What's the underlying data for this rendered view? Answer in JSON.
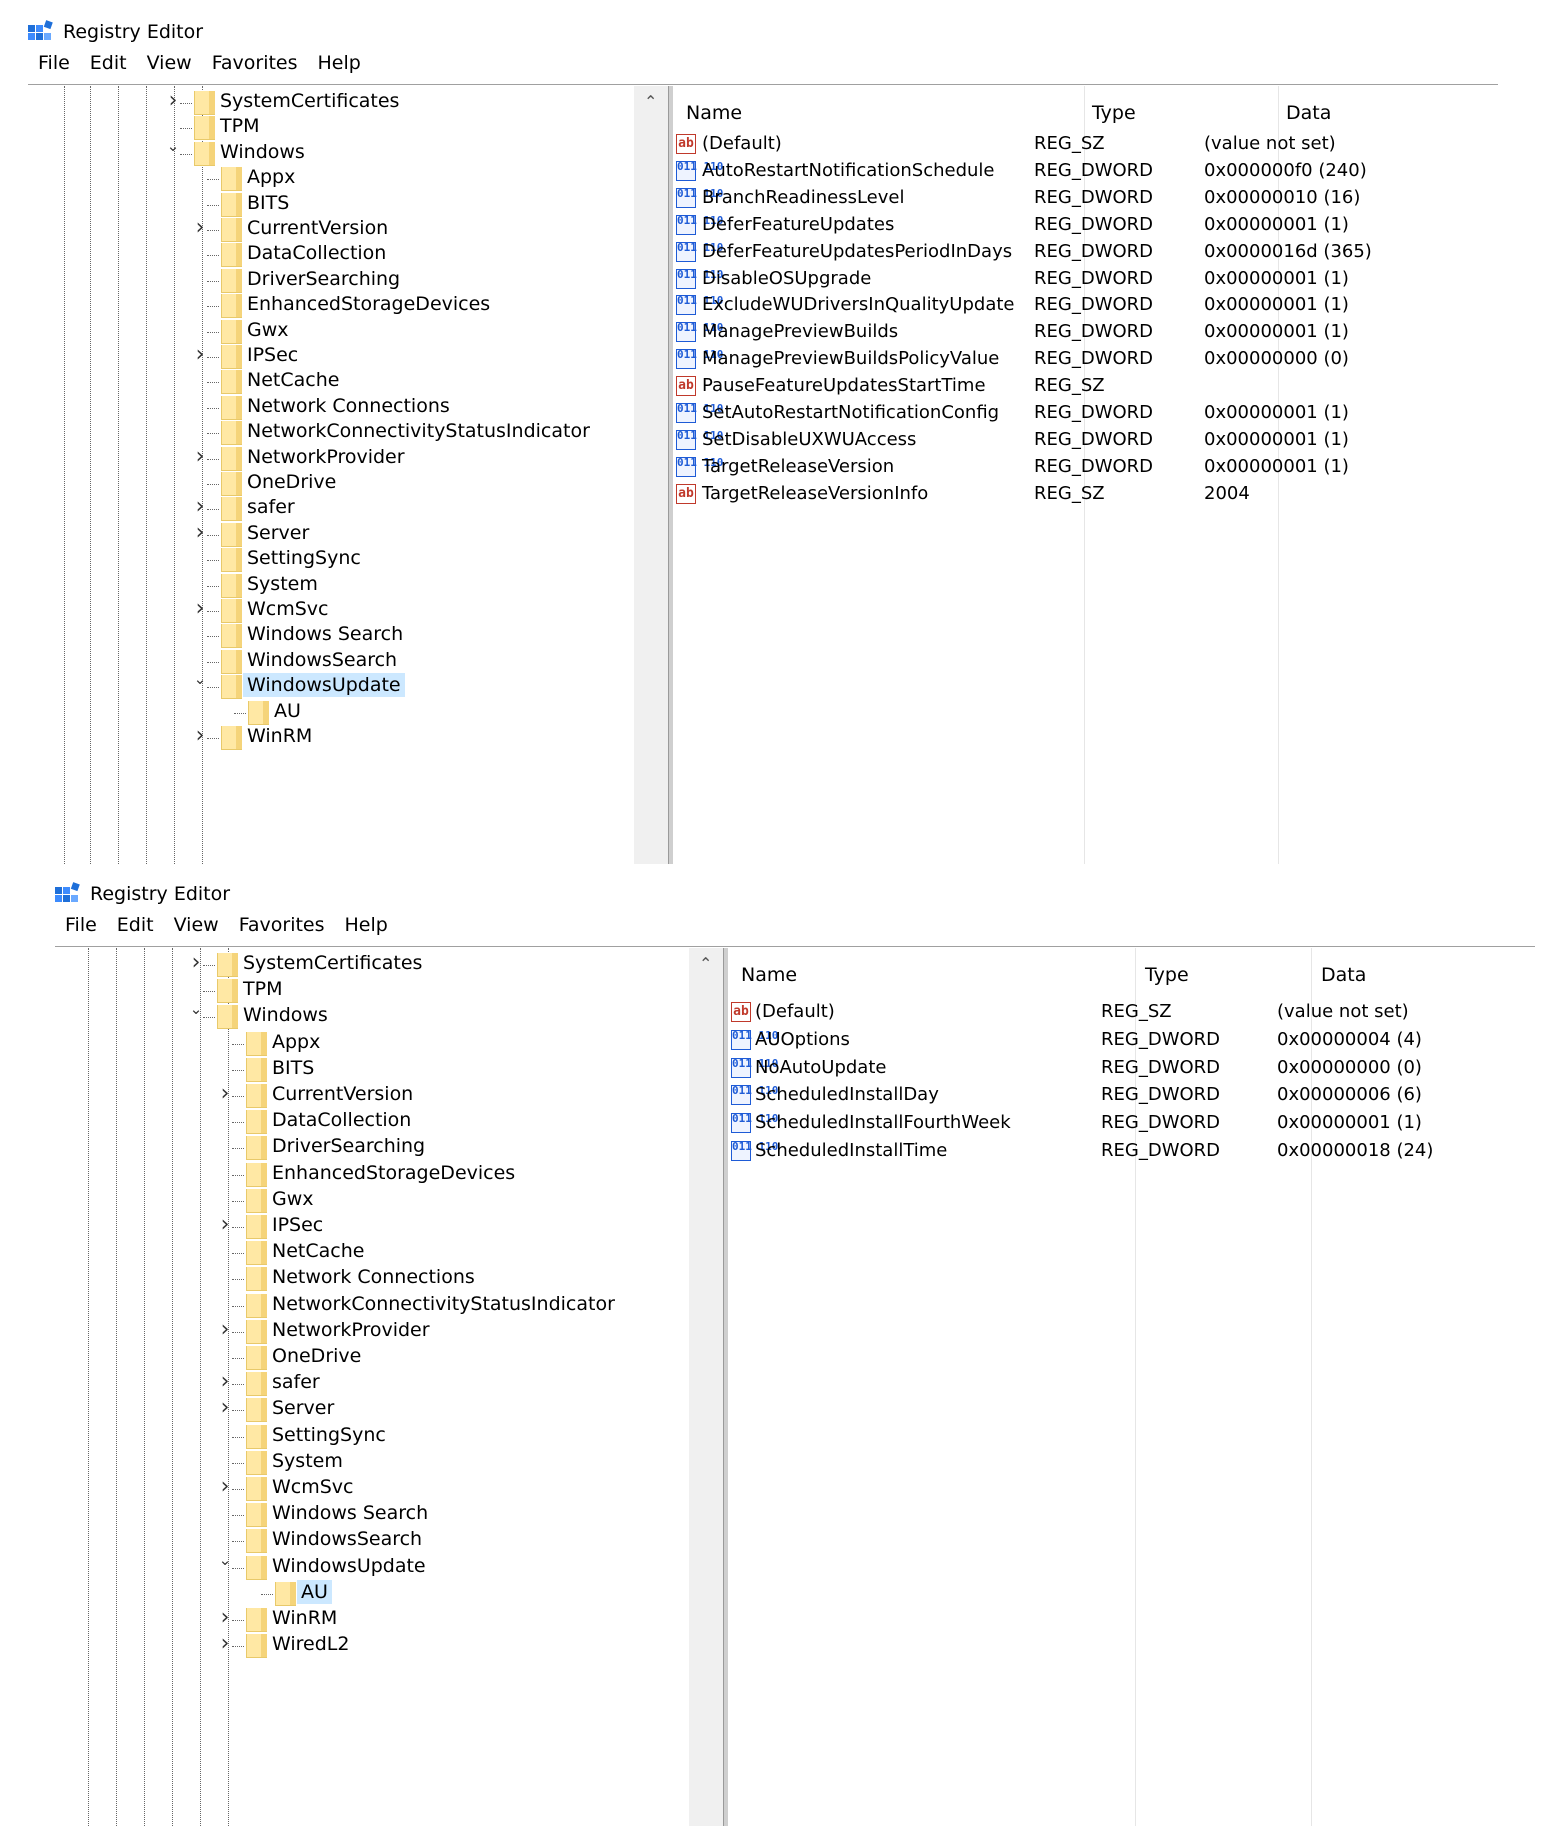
{
  "app_title": "Registry Editor",
  "menu": [
    "File",
    "Edit",
    "View",
    "Favorites",
    "Help"
  ],
  "columns": {
    "name": "Name",
    "type": "Type",
    "data": "Data"
  },
  "colors": {
    "selection": "#cce8ff",
    "folder": "#ffe8a4",
    "binary_icon": "#1e5bd6",
    "string_icon": "#c0392b"
  },
  "icons": {
    "string_value": "ab",
    "binary_value": "011 110"
  },
  "tree_items": [
    "SystemCertificates",
    "TPM",
    "Windows",
    "Appx",
    "BITS",
    "CurrentVersion",
    "DataCollection",
    "DriverSearching",
    "EnhancedStorageDevices",
    "Gwx",
    "IPSec",
    "NetCache",
    "Network Connections",
    "NetworkConnectivityStatusIndicator",
    "NetworkProvider",
    "OneDrive",
    "safer",
    "Server",
    "SettingSync",
    "System",
    "WcmSvc",
    "Windows Search",
    "WindowsSearch",
    "WindowsUpdate",
    "AU",
    "WinRM",
    "WiredL2"
  ],
  "window1": {
    "values": [
      {
        "name": "(Default)",
        "type": "REG_SZ",
        "data": "(value not set)"
      },
      {
        "name": "AutoRestartNotificationSchedule",
        "type": "REG_DWORD",
        "data": "0x000000f0 (240)"
      },
      {
        "name": "BranchReadinessLevel",
        "type": "REG_DWORD",
        "data": "0x00000010 (16)"
      },
      {
        "name": "DeferFeatureUpdates",
        "type": "REG_DWORD",
        "data": "0x00000001 (1)"
      },
      {
        "name": "DeferFeatureUpdatesPeriodInDays",
        "type": "REG_DWORD",
        "data": "0x0000016d (365)"
      },
      {
        "name": "DisableOSUpgrade",
        "type": "REG_DWORD",
        "data": "0x00000001 (1)"
      },
      {
        "name": "ExcludeWUDriversInQualityUpdate",
        "type": "REG_DWORD",
        "data": "0x00000001 (1)"
      },
      {
        "name": "ManagePreviewBuilds",
        "type": "REG_DWORD",
        "data": "0x00000001 (1)"
      },
      {
        "name": "ManagePreviewBuildsPolicyValue",
        "type": "REG_DWORD",
        "data": "0x00000000 (0)"
      },
      {
        "name": "PauseFeatureUpdatesStartTime",
        "type": "REG_SZ",
        "data": ""
      },
      {
        "name": "SetAutoRestartNotificationConfig",
        "type": "REG_DWORD",
        "data": "0x00000001 (1)"
      },
      {
        "name": "SetDisableUXWUAccess",
        "type": "REG_DWORD",
        "data": "0x00000001 (1)"
      },
      {
        "name": "TargetReleaseVersion",
        "type": "REG_DWORD",
        "data": "0x00000001 (1)"
      },
      {
        "name": "TargetReleaseVersionInfo",
        "type": "REG_SZ",
        "data": "2004"
      }
    ]
  },
  "window2": {
    "values": [
      {
        "name": "(Default)",
        "type": "REG_SZ",
        "data": "(value not set)"
      },
      {
        "name": "AUOptions",
        "type": "REG_DWORD",
        "data": "0x00000004 (4)"
      },
      {
        "name": "NoAutoUpdate",
        "type": "REG_DWORD",
        "data": "0x00000000 (0)"
      },
      {
        "name": "ScheduledInstallDay",
        "type": "REG_DWORD",
        "data": "0x00000006 (6)"
      },
      {
        "name": "ScheduledInstallFourthWeek",
        "type": "REG_DWORD",
        "data": "0x00000001 (1)"
      },
      {
        "name": "ScheduledInstallTime",
        "type": "REG_DWORD",
        "data": "0x00000018 (24)"
      }
    ]
  }
}
